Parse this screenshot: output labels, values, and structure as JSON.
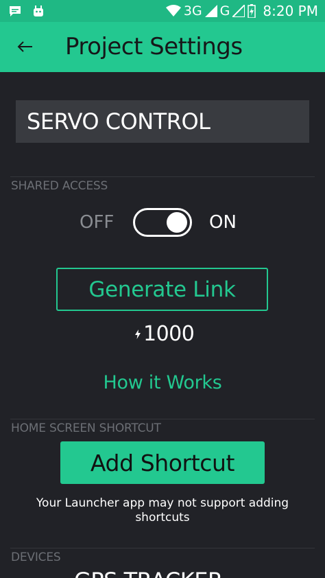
{
  "status_bar": {
    "left_icons": [
      "message-icon",
      "android-debug-icon"
    ],
    "network_3g": "3G",
    "network_g": "G",
    "time": "8:20 PM"
  },
  "app_bar": {
    "back_icon": "arrow-left-icon",
    "title": "Project Settings"
  },
  "project": {
    "name": "SERVO CONTROL"
  },
  "shared_access": {
    "label": "SHARED ACCESS",
    "toggle_off_label": "OFF",
    "toggle_on_label": "ON",
    "toggle_state": "on",
    "generate_link_label": "Generate Link",
    "energy_icon": "lightning-icon",
    "energy_value": "1000",
    "how_it_works_label": "How it Works"
  },
  "home_screen_shortcut": {
    "label": "HOME SCREEN SHORTCUT",
    "add_shortcut_label": "Add Shortcut",
    "note": "Your Launcher app may not support adding shortcuts"
  },
  "devices": {
    "label": "DEVICES",
    "first_device": "GPS TRACKER"
  },
  "colors": {
    "accent": "#23c890",
    "status_bar": "#1fb884",
    "background": "#212227",
    "field": "#393b40"
  }
}
